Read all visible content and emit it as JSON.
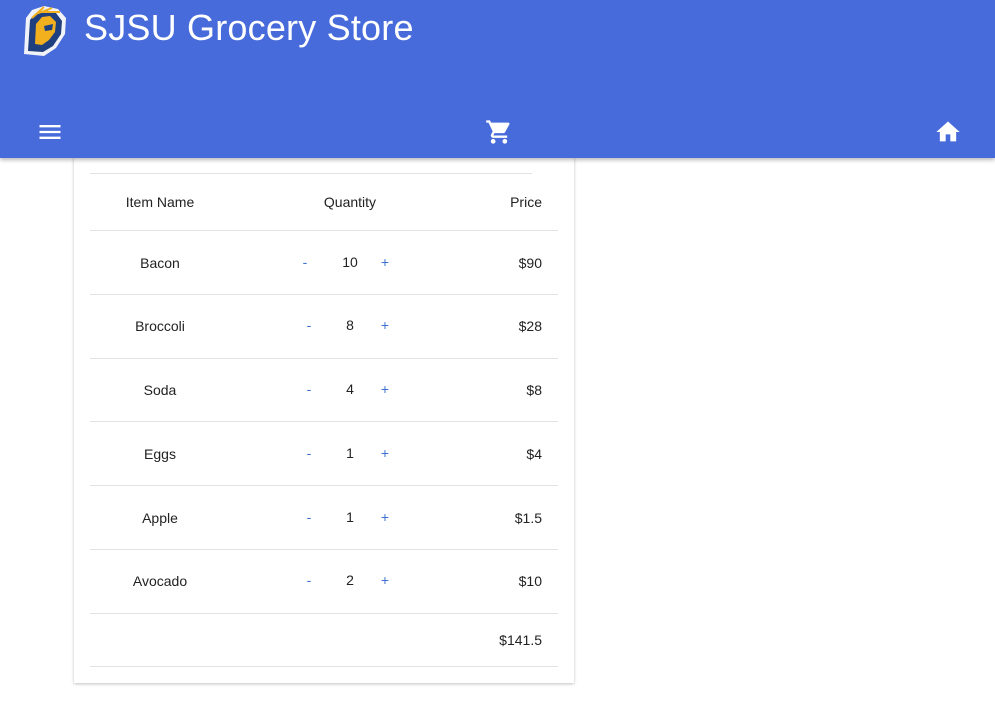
{
  "header": {
    "title": "SJSU Grocery Store",
    "logo_icon": "spartan-logo-icon",
    "bar_color": "#476bdb",
    "icons": [
      "menu-icon",
      "cart-icon",
      "home-icon"
    ]
  },
  "cart": {
    "columns": {
      "name": "Item Name",
      "quantity": "Quantity",
      "price": "Price"
    },
    "items": [
      {
        "name": "Bacon",
        "quantity": "10",
        "price": "$90"
      },
      {
        "name": "Broccoli",
        "quantity": "8",
        "price": "$28"
      },
      {
        "name": "Soda",
        "quantity": "4",
        "price": "$8"
      },
      {
        "name": "Eggs",
        "quantity": "1",
        "price": "$4"
      },
      {
        "name": "Apple",
        "quantity": "1",
        "price": "$1.5"
      },
      {
        "name": "Avocado",
        "quantity": "2",
        "price": "$10"
      }
    ],
    "decrement_label": "-",
    "increment_label": "+",
    "total": "$141.5",
    "accent_color": "#3f6fd0"
  }
}
